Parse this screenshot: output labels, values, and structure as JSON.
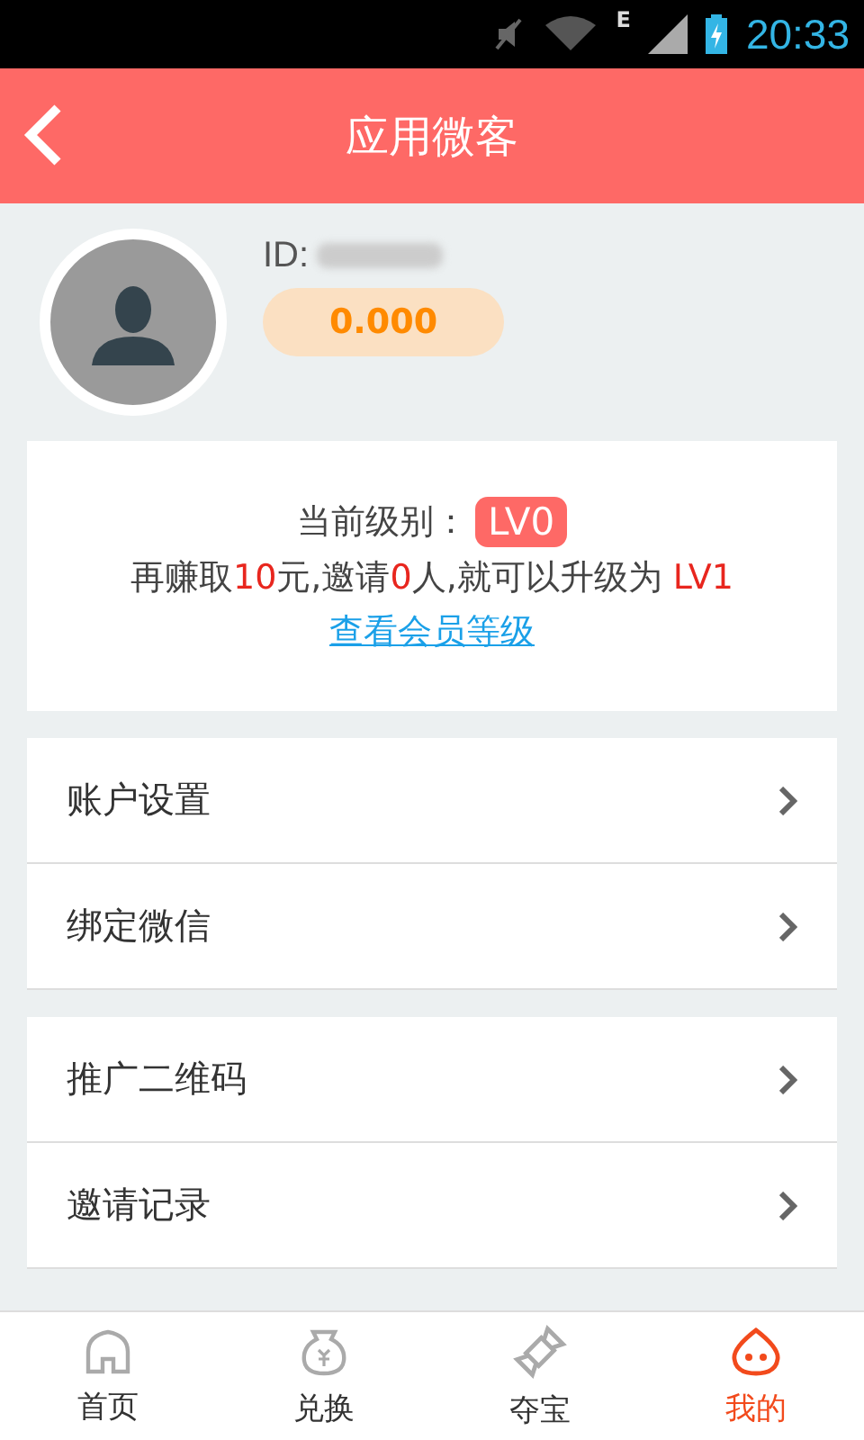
{
  "status_bar": {
    "network": "E",
    "time": "20:33"
  },
  "header": {
    "title": "应用微客"
  },
  "profile": {
    "id_label": "ID:",
    "balance": "0.000"
  },
  "level_card": {
    "label": "当前级别：",
    "level": "LV0",
    "hint": [
      {
        "text": "再赚取",
        "highlight": false
      },
      {
        "text": "10",
        "highlight": true
      },
      {
        "text": "元,邀请",
        "highlight": false
      },
      {
        "text": "0",
        "highlight": true
      },
      {
        "text": "人,就可以升级为 ",
        "highlight": false
      },
      {
        "text": "LV1",
        "highlight": true
      }
    ],
    "link": "查看会员等级"
  },
  "menu_groups": [
    [
      {
        "label": "账户设置"
      },
      {
        "label": "绑定微信"
      }
    ],
    [
      {
        "label": "推广二维码"
      },
      {
        "label": "邀请记录"
      }
    ]
  ],
  "tab_bar": [
    {
      "label": "首页",
      "kind": "home",
      "selected": false
    },
    {
      "label": "兑换",
      "kind": "exchange",
      "selected": false
    },
    {
      "label": "夺宝",
      "kind": "candy",
      "selected": false
    },
    {
      "label": "我的",
      "kind": "mine",
      "selected": true
    }
  ]
}
